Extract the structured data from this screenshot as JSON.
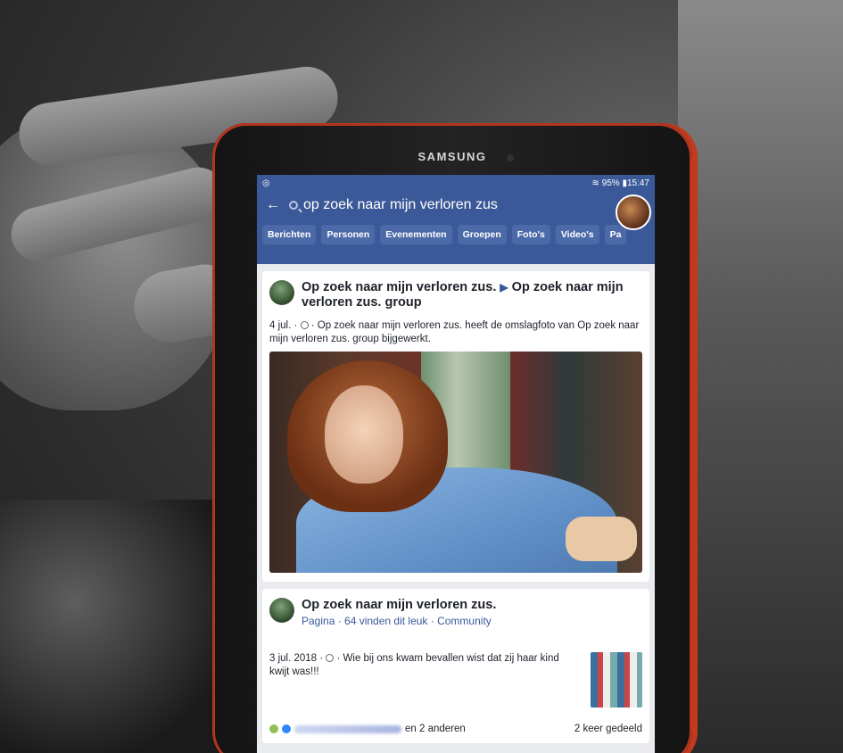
{
  "device": {
    "brand": "SAMSUNG"
  },
  "status": {
    "battery": "95%",
    "time": "15:47"
  },
  "search": {
    "query": "op zoek naar mijn verloren zus"
  },
  "tabs": [
    "Berichten",
    "Personen",
    "Evenementen",
    "Groepen",
    "Foto's",
    "Video's",
    "Pa"
  ],
  "post1": {
    "title_part1": "Op zoek naar mijn verloren zus.",
    "title_part2": "Op zoek naar mijn verloren zus. group",
    "date": "4 jul. ·",
    "text": "· Op zoek naar mijn verloren zus. heeft de omslagfoto van Op zoek naar mijn verloren zus. group bijgewerkt."
  },
  "post2": {
    "title": "Op zoek naar mijn verloren zus.",
    "subtitle": "Pagina · 64 vinden dit leuk · Community",
    "date": "3 jul. 2018 ·",
    "text": "· Wie bij ons kwam bevallen wist dat zij haar kind kwijt was!!!",
    "reactions_suffix": "en 2 anderen",
    "shares": "2 keer gedeeld"
  },
  "colors": {
    "facebook_blue": "#3b5998",
    "tablet_case": "#c23a1e"
  }
}
